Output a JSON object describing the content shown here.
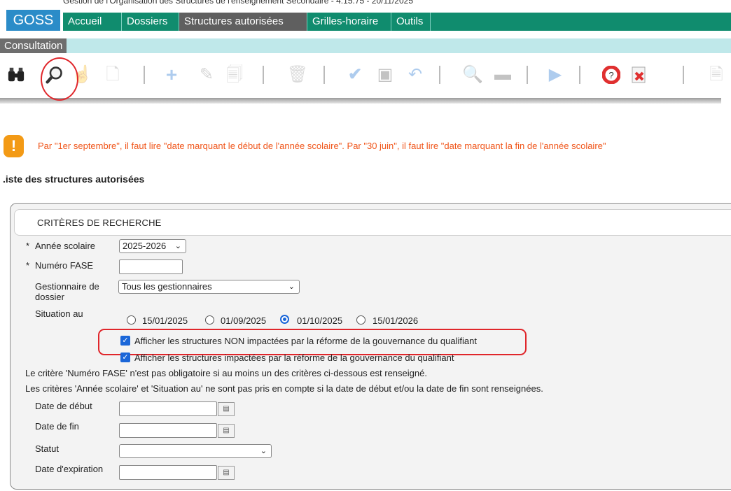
{
  "header": {
    "subtitle": "Gestion de l'Organisation des Structures de l'enseignement Secondaire - 4.15.75 - 20/11/2025",
    "logo": "GOSS",
    "menu": [
      "Accueil",
      "Dossiers",
      "Structures autorisées",
      "Grilles-horaire",
      "Outils"
    ],
    "active_menu": "Structures autorisées"
  },
  "subbar": {
    "tab": "Consultation"
  },
  "toolbar": {
    "icons": [
      "binoculars-icon",
      "magnifier-icon",
      "hand-pointer-icon",
      "new-document-icon",
      "add-icon",
      "edit-pencil-icon",
      "copy-document-icon",
      "delete-icon",
      "validate-check-icon",
      "save-icon",
      "undo-icon",
      "preview-icon",
      "print-icon",
      "play-icon",
      "help-icon",
      "close-icon",
      "export-icon"
    ]
  },
  "notice": {
    "text": "Par \"1er septembre\", il faut lire \"date marquant le début de l'année scolaire\". Par \"30 juin\", il faut lire \"date marquant la fin de l'année scolaire\""
  },
  "page_title": ".iste des structures autorisées",
  "search": {
    "header": "CRITÈRES DE RECHERCHE",
    "required_mark": "*",
    "annee_label": "Année scolaire",
    "annee_value": "2025-2026",
    "fase_label": "Numéro FASE",
    "fase_value": "",
    "gestionnaire_label_1": "Gestionnaire de",
    "gestionnaire_label_2": "dossier",
    "gestionnaire_value": "Tous les gestionnaires",
    "situation_label": "Situation au",
    "situation_options": [
      "15/01/2025",
      "01/09/2025",
      "01/10/2025",
      "15/01/2026"
    ],
    "situation_selected": "01/10/2025",
    "checkbox_non_impactees": "Afficher les structures NON impactées par la réforme de la gouvernance du qualifiant",
    "checkbox_impactees": "Afficher les structures impactées par la réforme de la gouvernance du qualifiant",
    "note_1": "Le critère 'Numéro FASE' n'est pas obligatoire si au moins un des critères ci-dessous est renseigné.",
    "note_2": "Les critères 'Année scolaire' et 'Situation au' ne sont pas pris en compte si la date de début et/ou la date de fin sont renseignées.",
    "date_debut_label": "Date de début",
    "date_fin_label": "Date de fin",
    "statut_label": "Statut",
    "statut_value": "",
    "expiration_label": "Date d'expiration"
  }
}
